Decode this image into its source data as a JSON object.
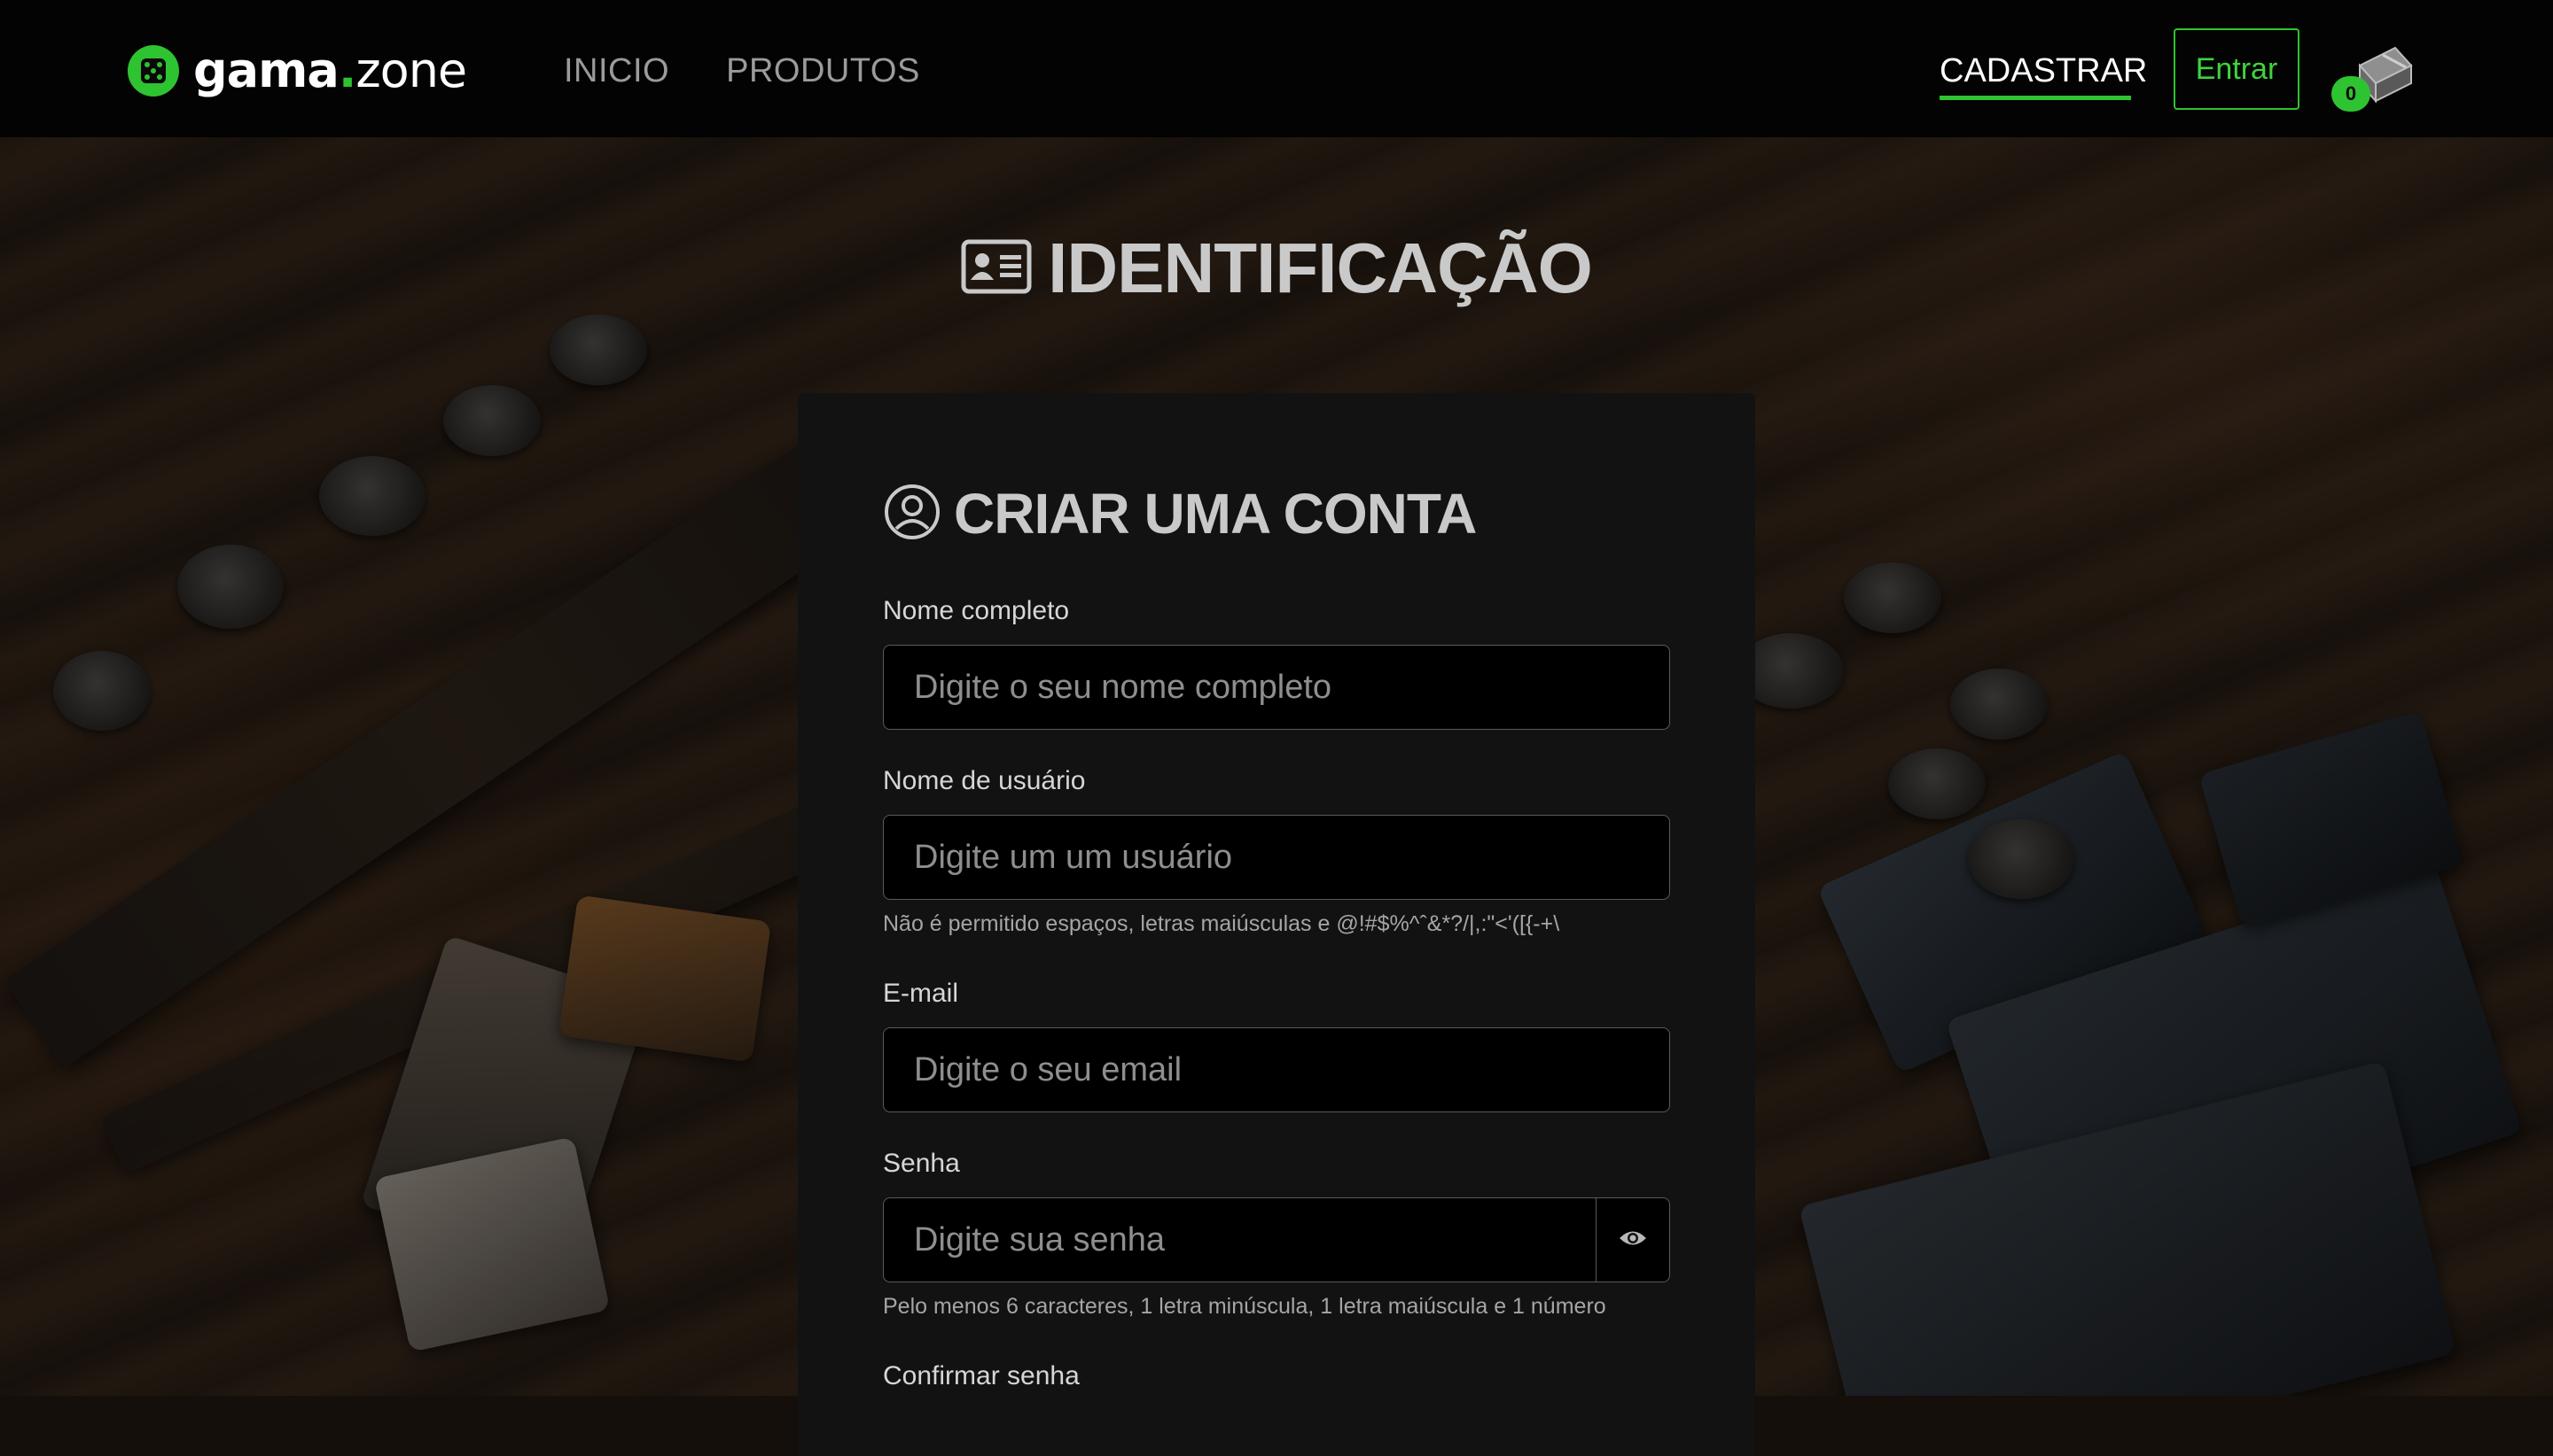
{
  "brand": {
    "name_main": "gama",
    "name_dot": ".",
    "name_sub": "zone",
    "accent_color": "#2ec331"
  },
  "nav": {
    "links": [
      "INICIO",
      "PRODUTOS"
    ],
    "register_label": "CADASTRAR",
    "login_label": "Entrar",
    "cart_icon": "cart-icon",
    "cart_count": "0"
  },
  "page": {
    "title": "IDENTIFICAÇÃO",
    "title_icon": "id-card-icon"
  },
  "form": {
    "title": "CRIAR UMA CONTA",
    "title_icon": "user-circle-icon",
    "fields": [
      {
        "label": "Nome completo",
        "placeholder": "Digite o seu nome completo",
        "value": "",
        "hint": ""
      },
      {
        "label": "Nome de usuário",
        "placeholder": "Digite um um usuário",
        "value": "",
        "hint": "Não é permitido espaços, letras maiúsculas e @!#$%^ˆ&*?/|,:\"<'([{-+\\"
      },
      {
        "label": "E-mail",
        "placeholder": "Digite o seu email",
        "value": "",
        "hint": ""
      },
      {
        "label": "Senha",
        "placeholder": "Digite sua senha",
        "value": "",
        "hint": "Pelo menos 6 caracteres, 1 letra minúscula, 1 letra maiúscula e 1 número",
        "toggle_icon": "eye-icon"
      },
      {
        "label": "Confirmar senha",
        "placeholder": "",
        "value": "",
        "hint": ""
      }
    ]
  }
}
